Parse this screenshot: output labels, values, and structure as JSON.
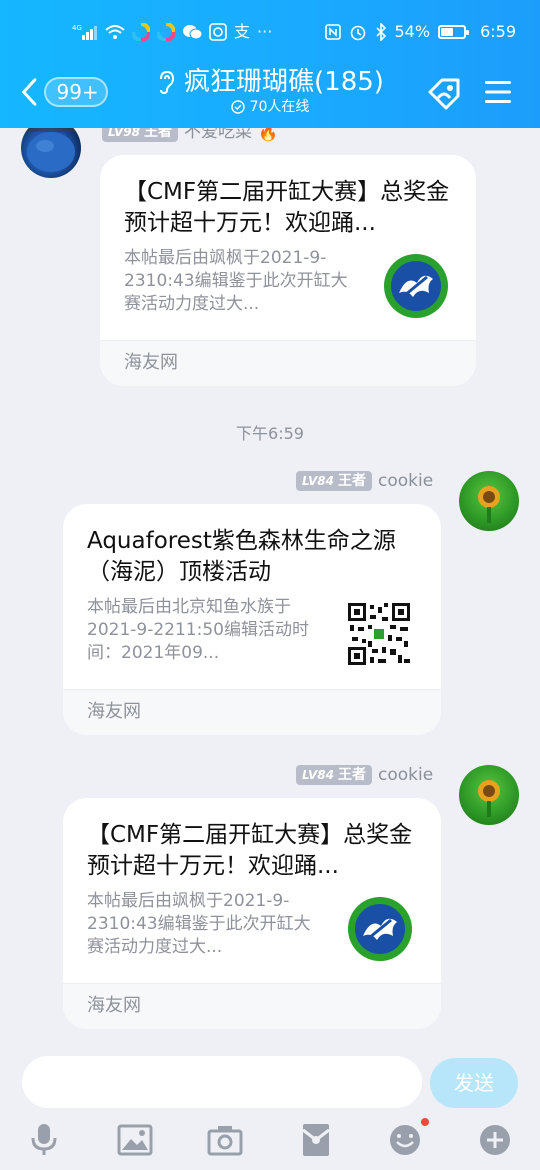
{
  "status_bar": {
    "network": "4G",
    "battery_percent": "54%",
    "battery_level": 0.54,
    "time": "6:59",
    "more": "···",
    "app_glyph": "支"
  },
  "header": {
    "back_badge": "99+",
    "group_name": "疯狂珊瑚礁(185)",
    "online_text": "70人在线",
    "bg_color": "#1aa9ff"
  },
  "messages": [
    {
      "sender_level": "LV98",
      "sender_rank": "王者",
      "sender_name": "不爱吃菜",
      "card_title": "【CMF第二届开缸大赛】总奖金预计超十万元！欢迎踊...",
      "card_desc": "本帖最后由飒枫于2021-9-2310:43编辑鉴于此次开缸大赛活动力度过大...",
      "card_source": "海友网"
    },
    {
      "timestamp": "下午6:59"
    },
    {
      "sender_level": "LV84",
      "sender_rank": "王者",
      "sender_name": "cookie",
      "card_title": "Aquaforest紫色森林生命之源（海泥）顶楼活动",
      "card_desc": "本帖最后由北京知鱼水族于2021-9-2211:50编辑活动时间：2021年09...",
      "card_source": "海友网"
    },
    {
      "sender_level": "LV84",
      "sender_rank": "王者",
      "sender_name": "cookie",
      "card_title": "【CMF第二届开缸大赛】总奖金预计超十万元！欢迎踊...",
      "card_desc": "本帖最后由飒枫于2021-9-2310:43编辑鉴于此次开缸大赛活动力度过大...",
      "card_source": "海友网"
    }
  ],
  "input": {
    "placeholder": "",
    "send_label": "发送"
  },
  "toolbar": {
    "items": [
      "microphone-icon",
      "image-icon",
      "camera-icon",
      "red-packet-icon",
      "emoji-icon",
      "plus-icon"
    ]
  }
}
